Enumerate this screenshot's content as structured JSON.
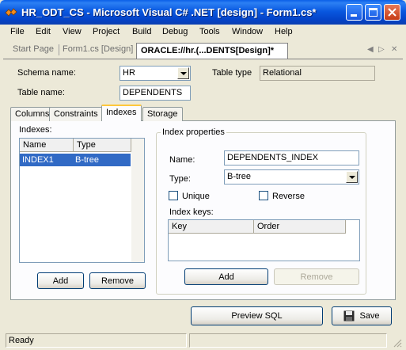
{
  "window": {
    "title": "HR_ODT_CS - Microsoft Visual C# .NET [design] - Form1.cs*"
  },
  "menu": [
    "File",
    "Edit",
    "View",
    "Project",
    "Build",
    "Debug",
    "Tools",
    "Window",
    "Help"
  ],
  "doc_tabs": {
    "start_page": "Start Page",
    "form1": "Form1.cs [Design]",
    "active": "ORACLE://hr.(...DENTS[Design]*"
  },
  "form": {
    "schema_label": "Schema name:",
    "schema_value": "HR",
    "table_type_label": "Table type",
    "table_type_value": "Relational",
    "table_label": "Table name:",
    "table_value": "DEPENDENTS"
  },
  "tabs": [
    "Columns",
    "Constraints",
    "Indexes",
    "Storage"
  ],
  "active_tab": "Indexes",
  "indexes": {
    "label": "Indexes:",
    "columns": [
      "Name",
      "Type"
    ],
    "rows": [
      {
        "name": "INDEX1",
        "type": "B-tree"
      }
    ],
    "add": "Add",
    "remove": "Remove"
  },
  "index_properties": {
    "title": "Index properties",
    "name_label": "Name:",
    "name_value": "DEPENDENTS_INDEX",
    "type_label": "Type:",
    "type_value": "B-tree",
    "unique_label": "Unique",
    "unique_checked": false,
    "reverse_label": "Reverse",
    "reverse_checked": false,
    "keys_label": "Index keys:",
    "keys_columns": [
      "Key",
      "Order"
    ],
    "add": "Add",
    "remove": "Remove"
  },
  "buttons": {
    "preview": "Preview SQL",
    "save": "Save"
  },
  "status": {
    "text": "Ready"
  }
}
